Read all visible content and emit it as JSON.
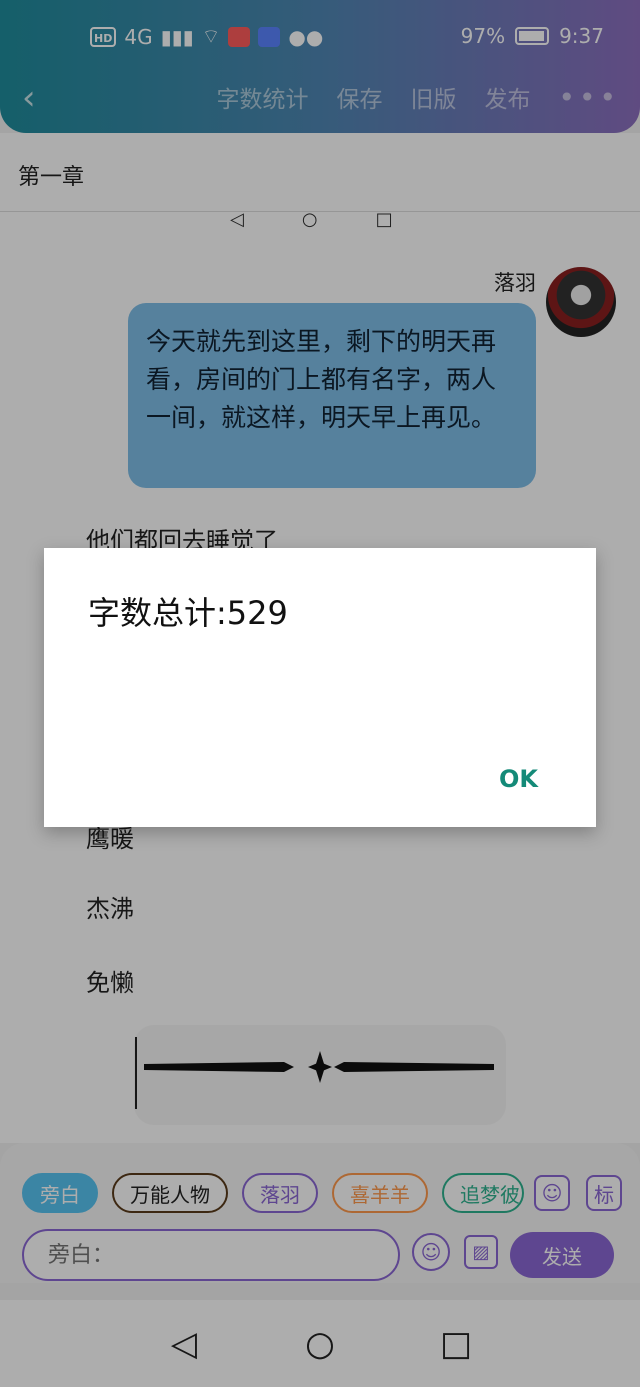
{
  "status_bar": {
    "hd": "HD",
    "network": "4G",
    "battery_percent": "97%",
    "time": "9:37"
  },
  "header": {
    "back_icon": "chevron-left-icon",
    "menu": [
      "字数统计",
      "保存",
      "旧版",
      "发布"
    ],
    "more_icon": "more-horizontal-icon"
  },
  "content": {
    "chapter": "第一章",
    "mini_nav_icons": [
      "triangle-left-icon",
      "circle-icon",
      "square-icon"
    ],
    "speaker": "落羽",
    "bubble_text": "今天就先到这里，剩下的明天再看，房间的门上都有名字，两人一间，就这样，明天早上再见。",
    "paragraphs": [
      "他们都回去睡觉了",
      "鹰暖",
      "杰沸",
      "免懒"
    ]
  },
  "editor": {
    "chips": [
      "旁白",
      "万能人物",
      "落羽",
      "喜羊羊",
      "追梦彼岸"
    ],
    "icon_person": "person-icon",
    "tag_label": "标",
    "input_placeholder": "旁白：",
    "emoji_icon": "smile-icon",
    "image_icon": "image-icon",
    "send_label": "发送"
  },
  "navbar": {
    "back": "triangle-left-icon",
    "home": "circle-icon",
    "recents": "square-icon"
  },
  "dialog": {
    "message": "字数总计:529",
    "ok_label": "OK"
  },
  "colors": {
    "gradient_start": "#1f8c9c",
    "gradient_end": "#8d6fbf",
    "accent_purple": "#8b67d4",
    "ok_green": "#148a78"
  }
}
